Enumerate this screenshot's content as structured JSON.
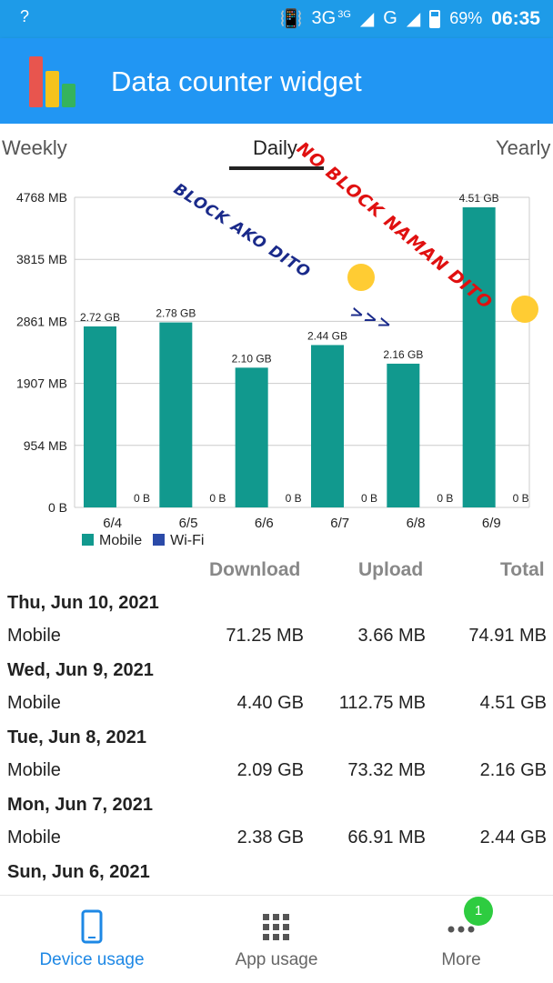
{
  "status_bar": {
    "left_indicator": "?",
    "network": "3G",
    "network_small": "3G",
    "network2": "G",
    "battery": "69%",
    "time": "06:35"
  },
  "app": {
    "title": "Data counter widget"
  },
  "tabs": [
    {
      "label": "Weekly",
      "active": false
    },
    {
      "label": "Daily",
      "active": true
    },
    {
      "label": "Yearly",
      "active": false
    }
  ],
  "colors": {
    "accent": "#2196f3",
    "mobile": "#11998e",
    "wifi": "#2b4aa8"
  },
  "chart_data": {
    "type": "bar",
    "categories": [
      "6/4",
      "6/5",
      "6/6",
      "6/7",
      "6/8",
      "6/9"
    ],
    "series": [
      {
        "name": "Mobile",
        "values": [
          2.72,
          2.78,
          2.1,
          2.44,
          2.16,
          4.51
        ],
        "labels": [
          "2.72 GB",
          "2.78 GB",
          "2.10 GB",
          "2.44 GB",
          "2.16 GB",
          "4.51 GB"
        ]
      },
      {
        "name": "Wi-Fi",
        "values": [
          0,
          0,
          0,
          0,
          0,
          0
        ],
        "labels": [
          "0 B",
          "0 B",
          "0 B",
          "0 B",
          "0 B",
          "0 B"
        ]
      }
    ],
    "yticks": [
      "0 B",
      "954 MB",
      "1907 MB",
      "2861 MB",
      "3815 MB",
      "4768 MB"
    ],
    "ylim": [
      0,
      4.66
    ],
    "legend_position": "bottom-left",
    "grid": true
  },
  "annotations": {
    "blue_text": "BLOCK AKO DITO",
    "red_text": "NO BLOCK NAMAN DITO",
    "arrow": ">>>"
  },
  "table": {
    "headers": {
      "download": "Download",
      "upload": "Upload",
      "total": "Total"
    },
    "days": [
      {
        "date": "Thu, Jun 10, 2021",
        "type": "Mobile",
        "download": "71.25 MB",
        "upload": "3.66 MB",
        "total": "74.91 MB"
      },
      {
        "date": "Wed, Jun 9, 2021",
        "type": "Mobile",
        "download": "4.40 GB",
        "upload": "112.75 MB",
        "total": "4.51 GB"
      },
      {
        "date": "Tue, Jun 8, 2021",
        "type": "Mobile",
        "download": "2.09 GB",
        "upload": "73.32 MB",
        "total": "2.16 GB"
      },
      {
        "date": "Mon, Jun 7, 2021",
        "type": "Mobile",
        "download": "2.38 GB",
        "upload": "66.91 MB",
        "total": "2.44 GB"
      },
      {
        "date": "Sun, Jun 6, 2021"
      }
    ]
  },
  "bottom_nav": [
    {
      "label": "Device usage",
      "icon": "phone-icon",
      "active": true
    },
    {
      "label": "App usage",
      "icon": "grid-icon",
      "active": false
    },
    {
      "label": "More",
      "icon": "more-icon",
      "active": false,
      "badge": "1"
    }
  ]
}
